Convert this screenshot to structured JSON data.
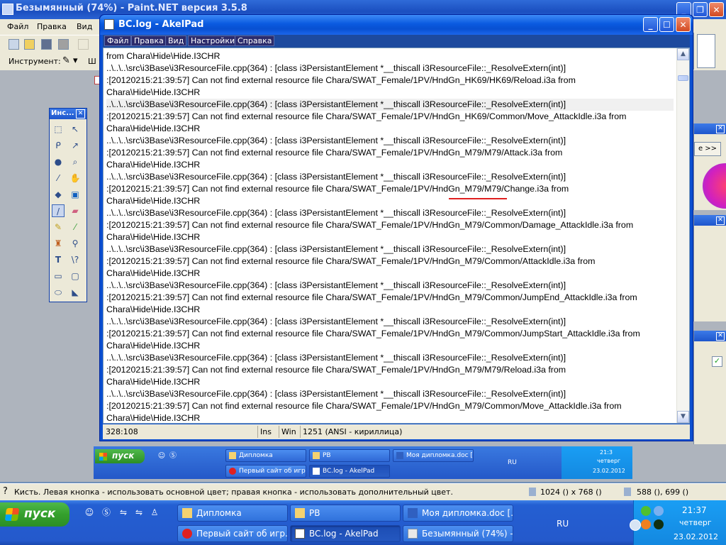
{
  "paintnet": {
    "title": "Безымянный (74%) - Paint.NET версия 3.5.8",
    "menu": [
      "Файл",
      "Правка",
      "Вид"
    ],
    "tool_label": "Инструмент:",
    "tool_extra": "Ш",
    "tools_panel_title": "Инс...",
    "status_hint": "Кисть. Левая кнопка - использовать основной цвет; правая кнопка - использовать дополнительный цвет.",
    "image_size": "1024 () x 768 ()",
    "cursor_pos": "588 (), 699 ()",
    "right_button": "е >>"
  },
  "akelpad": {
    "title": "BC.log - AkelPad",
    "menu": [
      "Файл",
      "Правка",
      "Вид",
      "Настройки",
      "Справка"
    ],
    "lines": [
      "from Chara\\Hide\\Hide.I3CHR",
      "..\\..\\..\\src\\i3Base\\i3ResourceFile.cpp(364) : [class i3PersistantElement *__thiscall i3ResourceFile::_ResolveExtern(int)]",
      ":[20120215:21:39:57] Can not find external resource file Chara/SWAT_Female/1PV/HndGn_HK69/HK69/Reload.i3a from",
      "Chara\\Hide\\Hide.I3CHR",
      "..\\..\\..\\src\\i3Base\\i3ResourceFile.cpp(364) : [class i3PersistantElement *__thiscall i3ResourceFile::_ResolveExtern(int)]",
      ":[20120215:21:39:57] Can not find external resource file Chara/SWAT_Female/1PV/HndGn_HK69/Common/Move_AttackIdle.i3a from",
      "Chara\\Hide\\Hide.I3CHR",
      "..\\..\\..\\src\\i3Base\\i3ResourceFile.cpp(364) : [class i3PersistantElement *__thiscall i3ResourceFile::_ResolveExtern(int)]",
      ":[20120215:21:39:57] Can not find external resource file Chara/SWAT_Female/1PV/HndGn_M79/M79/Attack.i3a from",
      "Chara\\Hide\\Hide.I3CHR",
      "..\\..\\..\\src\\i3Base\\i3ResourceFile.cpp(364) : [class i3PersistantElement *__thiscall i3ResourceFile::_ResolveExtern(int)]",
      ":[20120215:21:39:57] Can not find external resource file Chara/SWAT_Female/1PV/HndGn_M79/M79/Change.i3a from",
      "Chara\\Hide\\Hide.I3CHR",
      "..\\..\\..\\src\\i3Base\\i3ResourceFile.cpp(364) : [class i3PersistantElement *__thiscall i3ResourceFile::_ResolveExtern(int)]",
      ":[20120215:21:39:57] Can not find external resource file Chara/SWAT_Female/1PV/HndGn_M79/Common/Damage_AttackIdle.i3a from",
      "Chara\\Hide\\Hide.I3CHR",
      "..\\..\\..\\src\\i3Base\\i3ResourceFile.cpp(364) : [class i3PersistantElement *__thiscall i3ResourceFile::_ResolveExtern(int)]",
      ":[20120215:21:39:57] Can not find external resource file Chara/SWAT_Female/1PV/HndGn_M79/Common/AttackIdle.i3a from",
      "Chara\\Hide\\Hide.I3CHR",
      "..\\..\\..\\src\\i3Base\\i3ResourceFile.cpp(364) : [class i3PersistantElement *__thiscall i3ResourceFile::_ResolveExtern(int)]",
      ":[20120215:21:39:57] Can not find external resource file Chara/SWAT_Female/1PV/HndGn_M79/Common/JumpEnd_AttackIdle.i3a from",
      "Chara\\Hide\\Hide.I3CHR",
      "..\\..\\..\\src\\i3Base\\i3ResourceFile.cpp(364) : [class i3PersistantElement *__thiscall i3ResourceFile::_ResolveExtern(int)]",
      ":[20120215:21:39:57] Can not find external resource file Chara/SWAT_Female/1PV/HndGn_M79/Common/JumpStart_AttackIdle.i3a from",
      "Chara\\Hide\\Hide.I3CHR",
      "..\\..\\..\\src\\i3Base\\i3ResourceFile.cpp(364) : [class i3PersistantElement *__thiscall i3ResourceFile::_ResolveExtern(int)]",
      ":[20120215:21:39:57] Can not find external resource file Chara/SWAT_Female/1PV/HndGn_M79/M79/Reload.i3a from",
      "Chara\\Hide\\Hide.I3CHR",
      "..\\..\\..\\src\\i3Base\\i3ResourceFile.cpp(364) : [class i3PersistantElement *__thiscall i3ResourceFile::_ResolveExtern(int)]",
      ":[20120215:21:39:57] Can not find external resource file Chara/SWAT_Female/1PV/HndGn_M79/Common/Move_AttackIdle.i3a from",
      "Chara\\Hide\\Hide.I3CHR"
    ],
    "status": {
      "position": "328:108",
      "mode": "Ins",
      "eol": "Win",
      "encoding": "1251  (ANSI - кириллица)"
    }
  },
  "inner_taskbar": {
    "start_label": "пуск",
    "tasks": [
      "Дипломка",
      "РВ",
      "Моя дипломка.doc [...",
      "Первый сайт об игр...",
      "BC.log - AkelPad"
    ],
    "lang": "RU",
    "time": "21:3",
    "day": "четверг",
    "date": "23.02.2012"
  },
  "taskbar": {
    "start_label": "пуск",
    "tasks": [
      "Дипломка",
      "РВ",
      "Моя дипломка.doc [...",
      "Первый сайт об игр...",
      "BC.log - AkelPad",
      "Безымянный (74%) -..."
    ],
    "lang": "RU",
    "time": "21:37",
    "day": "четверг",
    "date": "23.02.2012"
  },
  "colors": {
    "xp_blue": "#245fd2",
    "start_green": "#34a02c",
    "tray_blue": "#1388e0",
    "annotation_red": "#e02020"
  }
}
